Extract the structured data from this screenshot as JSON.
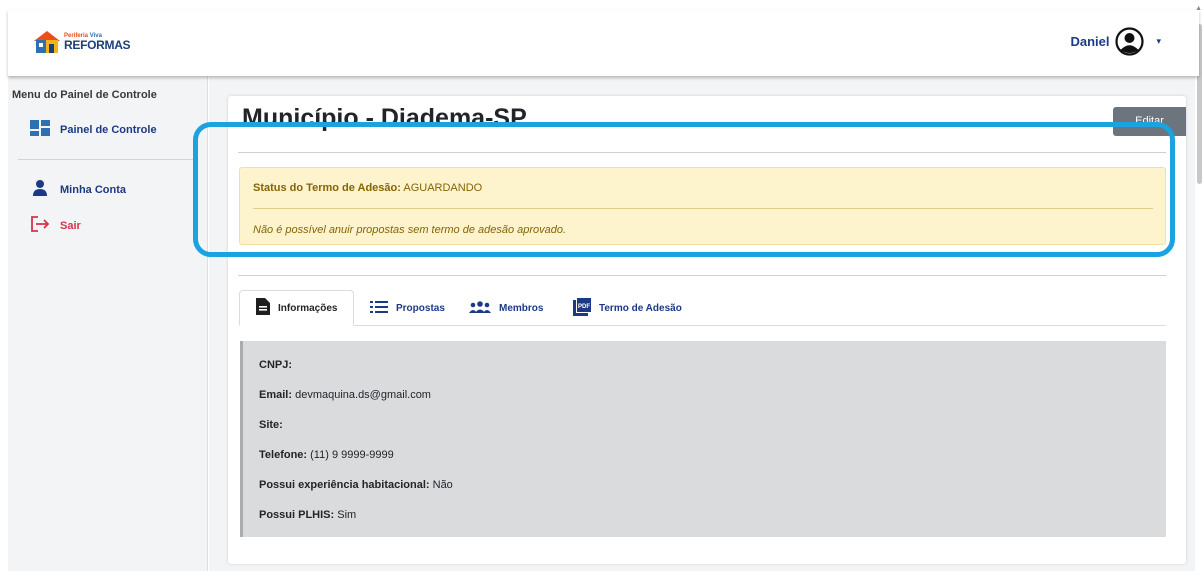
{
  "header": {
    "logo": {
      "line1_a": "Periferia",
      "line1_b": "Viva",
      "line2": "REFORMAS"
    },
    "user_name": "Daniel"
  },
  "sidebar": {
    "title": "Menu do Painel de Controle",
    "items": [
      {
        "label": "Painel de Controle",
        "icon": "dashboard-icon"
      },
      {
        "label": "Minha Conta",
        "icon": "user-icon"
      },
      {
        "label": "Sair",
        "icon": "logout-icon"
      }
    ]
  },
  "page": {
    "title": "Município - Diadema-SP",
    "edit_label": "Editar"
  },
  "alert": {
    "status_label": "Status do Termo de Adesão:",
    "status_value": "AGUARDANDO",
    "message": "Não é possível anuir propostas sem termo de adesão aprovado."
  },
  "tabs": [
    {
      "label": "Informações",
      "icon": "document-icon",
      "active": true
    },
    {
      "label": "Propostas",
      "icon": "list-icon",
      "active": false
    },
    {
      "label": "Membros",
      "icon": "users-icon",
      "active": false
    },
    {
      "label": "Termo de Adesão",
      "icon": "pdf-icon",
      "active": false
    }
  ],
  "info": {
    "cnpj_label": "CNPJ:",
    "cnpj_value": "",
    "email_label": "Email:",
    "email_value": "devmaquina.ds@gmail.com",
    "site_label": "Site:",
    "site_value": "",
    "telefone_label": "Telefone:",
    "telefone_value": "(11) 9 9999-9999",
    "experiencia_label": "Possui experiência habitacional:",
    "experiencia_value": "Não",
    "plhis_label": "Possui PLHIS:",
    "plhis_value": "Sim"
  },
  "colors": {
    "brand_blue": "#1c3a84",
    "logout_red": "#d6314a",
    "alert_bg": "#fdf3cd",
    "alert_text": "#856404",
    "annotation": "#1aa3e0",
    "edit_button": "#6c757d"
  }
}
